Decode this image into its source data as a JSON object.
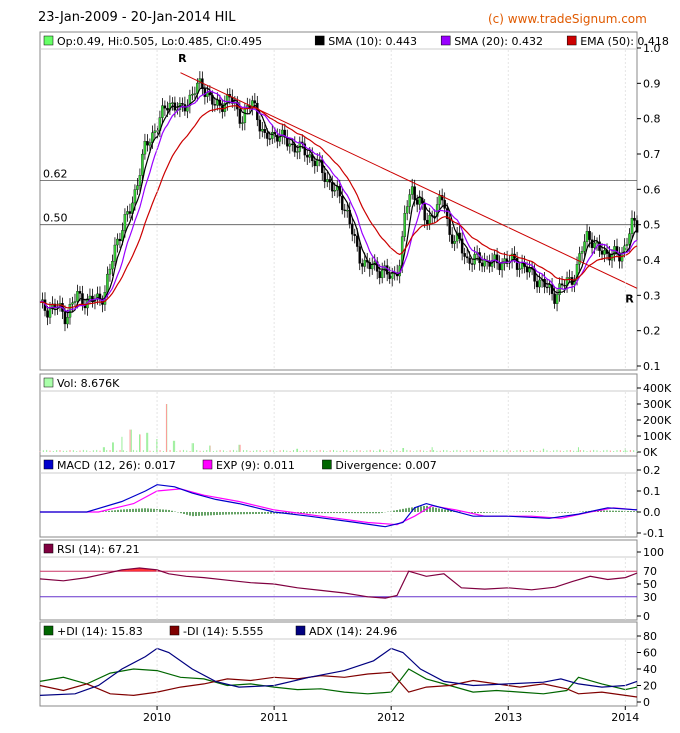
{
  "header": {
    "title": "23-Jan-2009 - 20-Jan-2014 HIL",
    "copyright": "(c) www.tradeSignum.com"
  },
  "colors": {
    "sma10": "#000000",
    "sma20": "#9900ff",
    "ema50": "#cc0000",
    "up": "#33cc33",
    "down": "#000000",
    "trend": "#cc0000",
    "macd": "#0000cc",
    "exp": "#ff00ff",
    "div": "#006600",
    "rsi": "#800040",
    "pdi": "#006600",
    "mdi": "#800000",
    "adx": "#000080",
    "rsiFill": "#ff3333",
    "rsiFillLow": "#6633cc"
  },
  "chart_data": [
    {
      "type": "line",
      "panel": "price",
      "legend": [
        "Op:0.49, Hi:0.505, Lo:0.485, Cl:0.495",
        "SMA (10): 0.443",
        "SMA (20): 0.432",
        "EMA (50): 0.418"
      ],
      "ylim": [
        0.1,
        1.0
      ],
      "yticks": [
        "1.0",
        "0.9",
        "0.8",
        "0.7",
        "0.6",
        "0.5",
        "0.4",
        "0.3",
        "0.2",
        "0.1"
      ],
      "xticks": [
        "2010",
        "2011",
        "2012",
        "2013",
        "2014"
      ],
      "fib_levels": [
        {
          "label": "0.62",
          "value": 0.625
        },
        {
          "label": "0.50",
          "value": 0.5
        }
      ],
      "trendline": {
        "start": [
          0.0,
          0.93
        ],
        "end": [
          5.0,
          0.32
        ]
      },
      "trend_labels": [
        "R",
        "R"
      ],
      "close_anchors": [
        [
          0.0,
          0.27
        ],
        [
          0.06,
          0.26
        ],
        [
          0.14,
          0.27
        ],
        [
          0.22,
          0.24
        ],
        [
          0.32,
          0.3
        ],
        [
          0.4,
          0.28
        ],
        [
          0.55,
          0.3
        ],
        [
          0.65,
          0.45
        ],
        [
          0.78,
          0.55
        ],
        [
          0.9,
          0.72
        ],
        [
          1.0,
          0.78
        ],
        [
          1.1,
          0.85
        ],
        [
          1.2,
          0.82
        ],
        [
          1.3,
          0.87
        ],
        [
          1.38,
          0.9
        ],
        [
          1.5,
          0.83
        ],
        [
          1.62,
          0.86
        ],
        [
          1.72,
          0.8
        ],
        [
          1.82,
          0.85
        ],
        [
          1.92,
          0.74
        ],
        [
          2.02,
          0.76
        ],
        [
          2.12,
          0.73
        ],
        [
          2.25,
          0.71
        ],
        [
          2.35,
          0.68
        ],
        [
          2.45,
          0.63
        ],
        [
          2.55,
          0.58
        ],
        [
          2.62,
          0.54
        ],
        [
          2.72,
          0.41
        ],
        [
          2.82,
          0.38
        ],
        [
          2.95,
          0.37
        ],
        [
          3.0,
          0.34
        ],
        [
          3.08,
          0.4
        ],
        [
          3.12,
          0.54
        ],
        [
          3.18,
          0.6
        ],
        [
          3.25,
          0.56
        ],
        [
          3.3,
          0.5
        ],
        [
          3.38,
          0.55
        ],
        [
          3.45,
          0.57
        ],
        [
          3.5,
          0.47
        ],
        [
          3.58,
          0.45
        ],
        [
          3.65,
          0.4
        ],
        [
          3.75,
          0.4
        ],
        [
          3.9,
          0.39
        ],
        [
          4.0,
          0.4
        ],
        [
          4.1,
          0.39
        ],
        [
          4.2,
          0.36
        ],
        [
          4.3,
          0.33
        ],
        [
          4.4,
          0.3
        ],
        [
          4.5,
          0.34
        ],
        [
          4.58,
          0.36
        ],
        [
          4.62,
          0.42
        ],
        [
          4.68,
          0.48
        ],
        [
          4.75,
          0.43
        ],
        [
          4.85,
          0.42
        ],
        [
          4.95,
          0.41
        ],
        [
          5.0,
          0.44
        ],
        [
          5.05,
          0.5
        ],
        [
          5.1,
          0.49
        ]
      ]
    },
    {
      "type": "bar",
      "panel": "volume",
      "legend": [
        "Vol: 8.676K"
      ],
      "ylim": [
        0,
        400000
      ],
      "yticks": [
        "400K",
        "300K",
        "200K",
        "100K",
        "0K"
      ],
      "spikes": [
        [
          0.55,
          30000
        ],
        [
          0.62,
          60000
        ],
        [
          0.7,
          95000
        ],
        [
          0.78,
          140000
        ],
        [
          0.85,
          110000
        ],
        [
          0.92,
          120000
        ],
        [
          1.0,
          80000
        ],
        [
          1.08,
          300000
        ],
        [
          1.15,
          70000
        ],
        [
          1.3,
          55000
        ],
        [
          1.45,
          40000
        ],
        [
          1.7,
          45000
        ],
        [
          2.2,
          20000
        ],
        [
          2.9,
          15000
        ],
        [
          3.1,
          25000
        ],
        [
          3.35,
          30000
        ],
        [
          4.3,
          20000
        ],
        [
          4.6,
          30000
        ],
        [
          5.0,
          25000
        ]
      ]
    },
    {
      "type": "line",
      "panel": "macd",
      "legend": [
        "MACD (12, 26): 0.017",
        "EXP (9): 0.011",
        "Divergence: 0.007"
      ],
      "ylim": [
        -0.1,
        0.2
      ],
      "yticks": [
        "0.2",
        "0.1",
        "0.0",
        "-0.1"
      ],
      "macd": [
        [
          0.0,
          0.0
        ],
        [
          0.4,
          0.0
        ],
        [
          0.7,
          0.05
        ],
        [
          0.9,
          0.1
        ],
        [
          1.0,
          0.13
        ],
        [
          1.15,
          0.12
        ],
        [
          1.3,
          0.09
        ],
        [
          1.5,
          0.06
        ],
        [
          1.7,
          0.04
        ],
        [
          2.0,
          0.0
        ],
        [
          2.3,
          -0.02
        ],
        [
          2.7,
          -0.05
        ],
        [
          2.95,
          -0.07
        ],
        [
          3.1,
          -0.05
        ],
        [
          3.2,
          0.02
        ],
        [
          3.3,
          0.04
        ],
        [
          3.5,
          0.01
        ],
        [
          3.7,
          -0.02
        ],
        [
          4.0,
          -0.02
        ],
        [
          4.35,
          -0.03
        ],
        [
          4.6,
          -0.01
        ],
        [
          4.85,
          0.02
        ],
        [
          5.1,
          0.01
        ]
      ],
      "exp": [
        [
          0.0,
          0.0
        ],
        [
          0.5,
          0.0
        ],
        [
          0.8,
          0.04
        ],
        [
          1.0,
          0.1
        ],
        [
          1.2,
          0.11
        ],
        [
          1.4,
          0.08
        ],
        [
          1.7,
          0.05
        ],
        [
          2.0,
          0.01
        ],
        [
          2.4,
          -0.02
        ],
        [
          2.8,
          -0.05
        ],
        [
          3.05,
          -0.06
        ],
        [
          3.2,
          -0.02
        ],
        [
          3.35,
          0.03
        ],
        [
          3.55,
          0.01
        ],
        [
          3.8,
          -0.02
        ],
        [
          4.2,
          -0.02
        ],
        [
          4.45,
          -0.03
        ],
        [
          4.7,
          0.0
        ],
        [
          4.9,
          0.02
        ],
        [
          5.1,
          0.01
        ]
      ],
      "divergence": [
        [
          0.5,
          0.0
        ],
        [
          0.7,
          0.012
        ],
        [
          0.9,
          0.018
        ],
        [
          1.1,
          0.01
        ],
        [
          1.3,
          -0.02
        ],
        [
          1.6,
          -0.012
        ],
        [
          2.0,
          -0.008
        ],
        [
          2.5,
          -0.005
        ],
        [
          2.9,
          -0.006
        ],
        [
          3.15,
          0.02
        ],
        [
          3.3,
          0.03
        ],
        [
          3.45,
          0.012
        ],
        [
          3.7,
          -0.006
        ],
        [
          4.2,
          0.004
        ],
        [
          4.5,
          -0.004
        ],
        [
          4.75,
          0.008
        ],
        [
          5.1,
          0.004
        ]
      ]
    },
    {
      "type": "line",
      "panel": "rsi",
      "legend": [
        "RSI (14): 67.21"
      ],
      "ylim": [
        0,
        100
      ],
      "yticks": [
        "100",
        "50",
        "0"
      ],
      "levels": [
        "70",
        "30"
      ],
      "rsi": [
        [
          0.0,
          58
        ],
        [
          0.2,
          55
        ],
        [
          0.4,
          60
        ],
        [
          0.55,
          66
        ],
        [
          0.7,
          72
        ],
        [
          0.85,
          75
        ],
        [
          1.0,
          72
        ],
        [
          1.1,
          66
        ],
        [
          1.25,
          62
        ],
        [
          1.4,
          60
        ],
        [
          1.6,
          56
        ],
        [
          1.8,
          52
        ],
        [
          2.0,
          50
        ],
        [
          2.2,
          44
        ],
        [
          2.4,
          40
        ],
        [
          2.6,
          36
        ],
        [
          2.8,
          30
        ],
        [
          2.95,
          28
        ],
        [
          3.05,
          32
        ],
        [
          3.15,
          70
        ],
        [
          3.3,
          62
        ],
        [
          3.45,
          66
        ],
        [
          3.6,
          44
        ],
        [
          3.8,
          42
        ],
        [
          4.0,
          44
        ],
        [
          4.2,
          41
        ],
        [
          4.4,
          45
        ],
        [
          4.55,
          54
        ],
        [
          4.7,
          62
        ],
        [
          4.85,
          57
        ],
        [
          5.0,
          60
        ],
        [
          5.1,
          67
        ]
      ]
    },
    {
      "type": "line",
      "panel": "dmi",
      "legend": [
        "+DI (14): 15.83",
        "-DI (14): 5.555",
        "ADX (14): 24.96"
      ],
      "ylim": [
        0,
        80
      ],
      "yticks": [
        "80",
        "60",
        "40",
        "20",
        "0"
      ],
      "pdi": [
        [
          0.0,
          25
        ],
        [
          0.2,
          30
        ],
        [
          0.4,
          22
        ],
        [
          0.6,
          35
        ],
        [
          0.8,
          40
        ],
        [
          1.0,
          38
        ],
        [
          1.2,
          30
        ],
        [
          1.4,
          28
        ],
        [
          1.6,
          20
        ],
        [
          1.8,
          22
        ],
        [
          2.0,
          18
        ],
        [
          2.2,
          15
        ],
        [
          2.4,
          16
        ],
        [
          2.6,
          12
        ],
        [
          2.8,
          10
        ],
        [
          3.0,
          12
        ],
        [
          3.15,
          40
        ],
        [
          3.3,
          28
        ],
        [
          3.5,
          20
        ],
        [
          3.7,
          12
        ],
        [
          3.9,
          14
        ],
        [
          4.1,
          12
        ],
        [
          4.3,
          10
        ],
        [
          4.5,
          14
        ],
        [
          4.6,
          30
        ],
        [
          4.8,
          22
        ],
        [
          5.0,
          15
        ],
        [
          5.1,
          18
        ]
      ],
      "mdi": [
        [
          0.0,
          20
        ],
        [
          0.2,
          14
        ],
        [
          0.4,
          22
        ],
        [
          0.6,
          10
        ],
        [
          0.8,
          8
        ],
        [
          1.0,
          12
        ],
        [
          1.2,
          18
        ],
        [
          1.4,
          22
        ],
        [
          1.6,
          28
        ],
        [
          1.8,
          26
        ],
        [
          2.0,
          30
        ],
        [
          2.2,
          28
        ],
        [
          2.4,
          32
        ],
        [
          2.6,
          30
        ],
        [
          2.8,
          34
        ],
        [
          3.0,
          36
        ],
        [
          3.15,
          12
        ],
        [
          3.3,
          18
        ],
        [
          3.5,
          20
        ],
        [
          3.7,
          26
        ],
        [
          3.9,
          22
        ],
        [
          4.1,
          18
        ],
        [
          4.3,
          22
        ],
        [
          4.5,
          16
        ],
        [
          4.6,
          10
        ],
        [
          4.8,
          12
        ],
        [
          5.0,
          8
        ],
        [
          5.1,
          6
        ]
      ],
      "adx": [
        [
          0.0,
          8
        ],
        [
          0.3,
          10
        ],
        [
          0.5,
          20
        ],
        [
          0.7,
          40
        ],
        [
          0.9,
          55
        ],
        [
          1.0,
          65
        ],
        [
          1.1,
          60
        ],
        [
          1.3,
          40
        ],
        [
          1.5,
          25
        ],
        [
          1.7,
          18
        ],
        [
          2.0,
          20
        ],
        [
          2.3,
          30
        ],
        [
          2.6,
          38
        ],
        [
          2.85,
          50
        ],
        [
          3.0,
          65
        ],
        [
          3.1,
          60
        ],
        [
          3.25,
          40
        ],
        [
          3.45,
          25
        ],
        [
          3.7,
          20
        ],
        [
          4.0,
          22
        ],
        [
          4.3,
          24
        ],
        [
          4.45,
          28
        ],
        [
          4.6,
          22
        ],
        [
          4.8,
          18
        ],
        [
          5.0,
          20
        ],
        [
          5.1,
          25
        ]
      ]
    }
  ]
}
